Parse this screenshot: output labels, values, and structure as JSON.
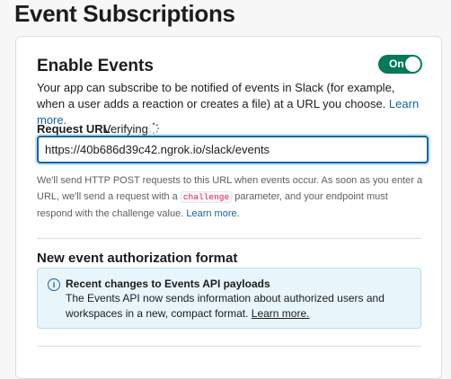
{
  "page": {
    "title": "Event Subscriptions"
  },
  "enable_events": {
    "title": "Enable Events",
    "toggle_label": "On",
    "toggle_state": "on",
    "description": "Your app can subscribe to be notified of events in Slack (for example, when a user adds a reaction or creates a file) at a URL you choose.",
    "learn_more": "Learn more."
  },
  "request_url": {
    "label": "Request URL",
    "status": "Verifying",
    "value": "https://40b686d39c42.ngrok.io/slack/events",
    "help_part1": "We'll send HTTP POST requests to this URL when events occur. As soon as you enter a URL, we'll send a request with a",
    "help_code": "challenge",
    "help_part2": "parameter, and your endpoint must respond with the challenge value.",
    "learn_more": "Learn more."
  },
  "auth_format": {
    "title": "New event authorization format",
    "info_title": "Recent changes to Events API payloads",
    "info_body": "The Events API now sends information about authorized users and workspaces in a new, compact format.",
    "learn_more": "Learn more."
  },
  "colors": {
    "toggle_on": "#007a5a",
    "link": "#1264a3",
    "info_bg": "#e8f5fa",
    "code_text": "#e01e5a"
  }
}
